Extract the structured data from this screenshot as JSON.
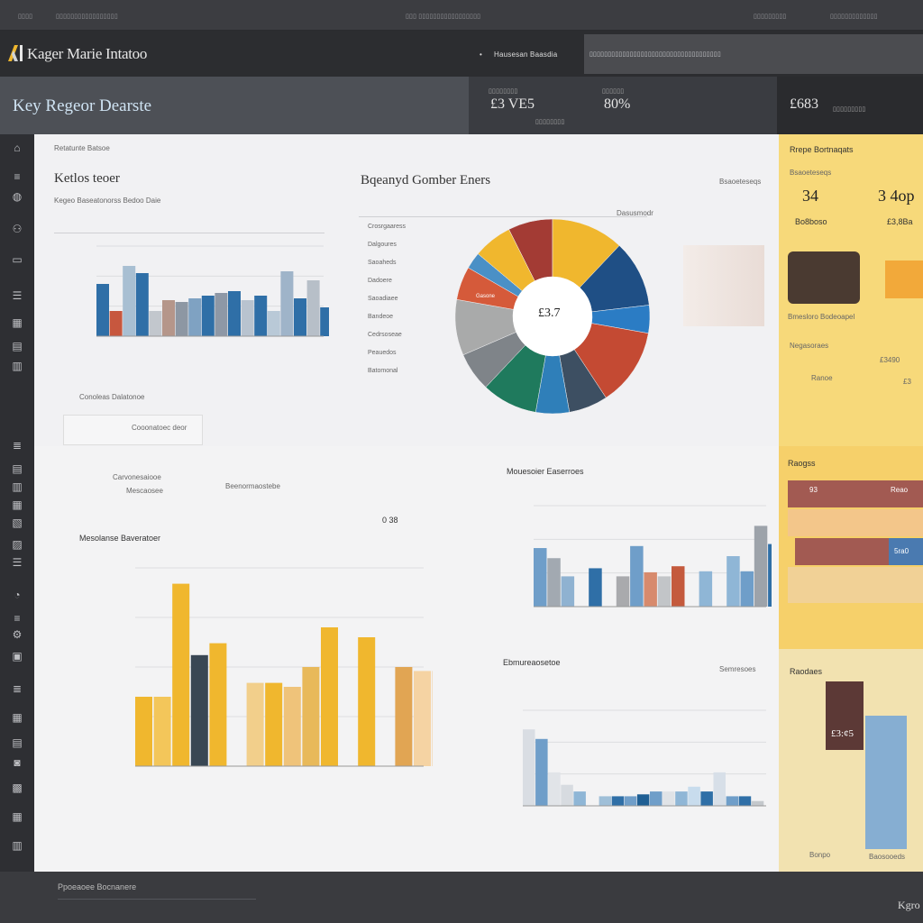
{
  "topbar": {
    "left_text": "▯▯▯▯",
    "left_text_2": "▯▯▯▯▯▯▯▯▯▯▯▯▯▯▯▯▯",
    "center_text": "▯▯▯ ▯▯▯▯▯▯▯▯▯▯▯▯▯▯▯▯▯",
    "right_text": "▯▯▯▯▯▯▯▯▯",
    "right_text_2": "▯▯▯▯▯▯▯▯▯▯▯▯▯"
  },
  "app": {
    "title": "Kager Marie Intatoo",
    "center_label": "Hausesan Baasdia",
    "right_label": "▯▯▯▯▯▯▯▯▯▯▯▯▯▯▯▯▯▯▯▯▯▯▯▯▯▯▯▯▯▯▯▯▯▯▯▯"
  },
  "header": {
    "page_title": "Key Regeor Dearste",
    "kpis": [
      {
        "value": "£3 VE5",
        "caption": "▯▯▯▯▯▯▯▯"
      },
      {
        "value": "80%",
        "caption": "▯▯▯▯▯▯"
      },
      {
        "value": "£683",
        "caption": "▯▯▯▯▯▯▯▯▯"
      }
    ]
  },
  "panels": {
    "top_left": {
      "overline": "Retatunte Batsoe",
      "title": "Ketlos teoer",
      "subtitle": "Kegeo Baseatonorss Bedoo Daie",
      "caption": "Conoleas Dalatonoe"
    },
    "top_center": {
      "title": "Bqeanyd Gomber Eners",
      "legend_caption": "Dasusmodr",
      "pie_center": "£3.7",
      "pie_label": "Gasone",
      "list_items": [
        "Crosrgaaress",
        "Dalgoures",
        "Saoaheds",
        "Dadoere",
        "Saoadiaee",
        "Bandeoe",
        "Cedrsoseae",
        "Peauedos",
        "Batomonal"
      ]
    },
    "mid_left": {
      "caption_a": "Cooonatoec deor",
      "caption_b": "Carvonesaiooe",
      "caption_c": "Mescaosee",
      "caption_d": "Beenormaostebe",
      "badge": "0 38"
    },
    "mid_right": {
      "title": "Mouesoier Easerroes"
    },
    "bottom_left": {
      "title": "Mesolanse Baveratoer"
    },
    "bottom_right": {
      "title": "Ebmureaosetoe",
      "aside": "Semresoes"
    }
  },
  "sidebar_right": {
    "title": "Rrepe Bortnaqats",
    "caption": "Bsaoeteseqs",
    "kpi_1": "34",
    "kpi_2": "3 4op",
    "sub_1": "Bo8boso",
    "sub_2": "£3,8Ba",
    "mid_caption": "Bmesloro Bodeoapel",
    "row_label": "Negasoraes",
    "row_value": "£3490",
    "row_label_2": "Ranoe",
    "row_value_2": "£3",
    "section_2": "Raogss",
    "bar_val_1": "93",
    "bar_val_2": "Reao",
    "bar_val_3": "5ra0",
    "section_3": "Raodaes",
    "tile_value": "£3:¢5",
    "foot_a": "Bonpo",
    "foot_b": "Baosooeds"
  },
  "footer": {
    "text": "Ppoeaoee Bocnanere",
    "brand": "Kgro"
  },
  "chart_data": [
    {
      "type": "bar",
      "title": "Ketlos teoer",
      "series": [
        {
          "values": [
            0,
            0,
            60,
            0,
            0,
            0,
            0,
            0,
            0,
            0,
            0,
            0,
            0,
            0,
            0,
            0,
            0,
            0,
            0,
            0,
            0
          ]
        },
        {
          "values": [
            0,
            0,
            0,
            0,
            0,
            0,
            0,
            0,
            0,
            0,
            0,
            0,
            0,
            0,
            0,
            0,
            0,
            0,
            0,
            0,
            0
          ]
        }
      ],
      "values": [
        58,
        28,
        78,
        70,
        28,
        40,
        38,
        42,
        45,
        48,
        50,
        40,
        45,
        28,
        72,
        42,
        62,
        32,
        48,
        70
      ],
      "colors": [
        "#2f6fa7",
        "#c7573e",
        "#a8bfd2",
        "#2f6fa7",
        "#c2c7cd",
        "#b5968a",
        "#8d97a3",
        "#7fa2c2",
        "#2f6fa7",
        "#8e98a6",
        "#2f6fa7",
        "#b8c3cf",
        "#2f6fa7",
        "#b9c9d7",
        "#9fb4c9",
        "#2f6fa7",
        "#b7bfc8",
        "#2f6fa7",
        "#c8cdd2",
        "#2f6fa7"
      ],
      "ylim": [
        0,
        100
      ]
    },
    {
      "type": "pie",
      "title": "Bqeanyd Gomber Eners",
      "values": [
        13,
        12,
        5,
        14,
        7,
        6,
        10,
        7,
        10,
        6,
        3,
        7
      ],
      "colors": [
        "#f0b72e",
        "#1f4f85",
        "#2b7cc4",
        "#c44a33",
        "#3d4f62",
        "#2f7fb9",
        "#1f7a5d",
        "#7f8489",
        "#a9aaaa",
        "#d55a3a",
        "#4a90c6",
        "#f0b72e"
      ],
      "start_color_slice": "#a33b34"
    },
    {
      "type": "bar",
      "title": "Mesolanse Baveratoer",
      "values": [
        35,
        35,
        92,
        56,
        62,
        0,
        42,
        42,
        40,
        50,
        70,
        0,
        65,
        0,
        50,
        48,
        48
      ],
      "colors": [
        "#f0b72e",
        "#f3c65a",
        "#f0b72e",
        "#394754",
        "#f0b72e",
        "#ffffff",
        "#f2cf8b",
        "#f0b72e",
        "#efc37a",
        "#e8b95a",
        "#f0b72e",
        "#ffffff",
        "#f0b72e",
        "#ffffff",
        "#e1a553",
        "#f5d3a3",
        "#efc17f"
      ],
      "ylim": [
        0,
        100
      ]
    },
    {
      "type": "bar",
      "title": "Mouesoier Easerroes",
      "values": [
        58,
        48,
        30,
        0,
        38,
        0,
        30,
        60,
        34,
        30,
        40,
        0,
        35,
        0,
        50,
        35,
        80,
        62
      ],
      "colors": [
        "#6f9ec9",
        "#a2a9b1",
        "#8fb2d1",
        "#ffffff",
        "#2f6fa7",
        "#ffffff",
        "#a9aaad",
        "#6f9ec9",
        "#d78a6d",
        "#c2c5c8",
        "#c45a3d",
        "#ffffff",
        "#8fb6d6",
        "#ffffff",
        "#8fb6d6",
        "#6f9ec9",
        "#9da3aa",
        "#2f6fa7"
      ],
      "ylim": [
        0,
        100
      ]
    },
    {
      "type": "bar",
      "title": "Ebmureaosetoe",
      "values": [
        80,
        70,
        35,
        22,
        15,
        0,
        10,
        10,
        10,
        12,
        15,
        15,
        15,
        20,
        15,
        35,
        10,
        10,
        5
      ],
      "colors": [
        "#d9dde3",
        "#6f9ec9",
        "#e1e4e8",
        "#d7dbe0",
        "#8fb6d6",
        "#ffffff",
        "#9fbfd8",
        "#2f6fa7",
        "#6f9ec9",
        "#1f5f94",
        "#6f9ec9",
        "#e0e3e7",
        "#8fb6d6",
        "#c8dced",
        "#2f6fa7",
        "#d7dfe8",
        "#6f9ec9",
        "#2f6fa7",
        "#c4c8cc"
      ],
      "ylim": [
        0,
        100
      ]
    }
  ]
}
